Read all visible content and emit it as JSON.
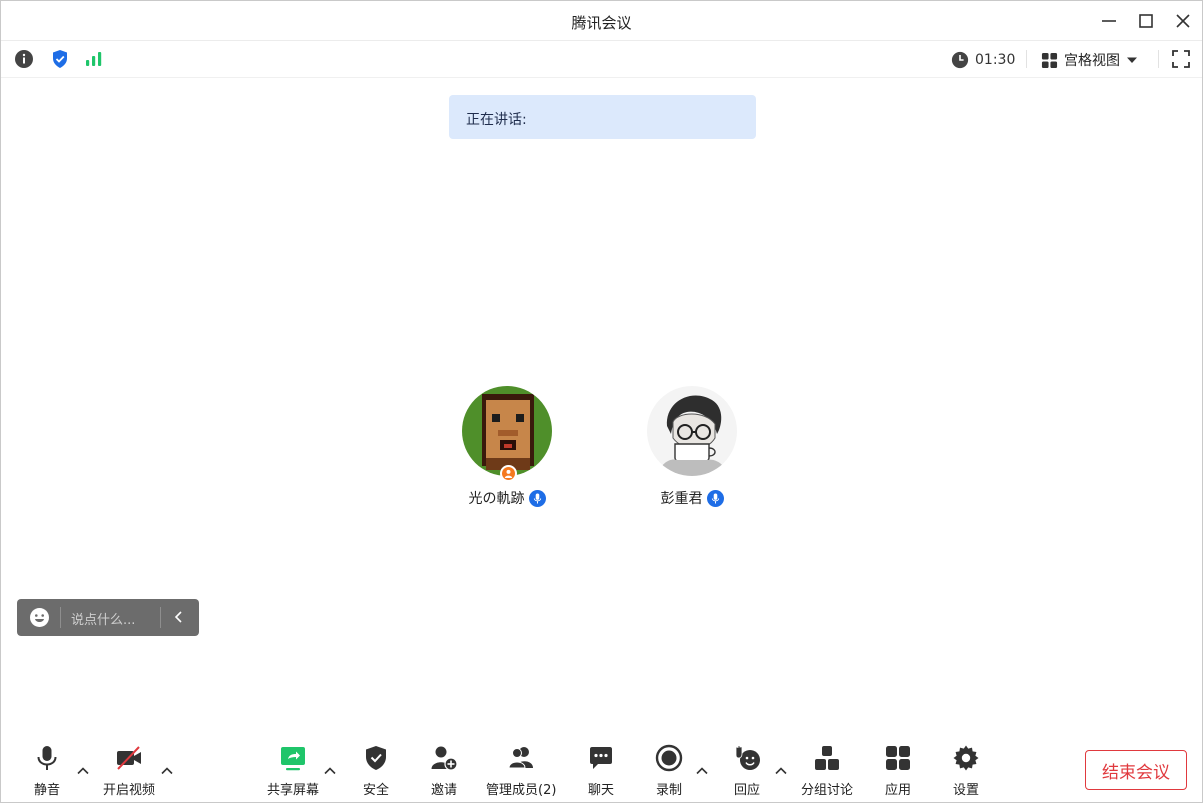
{
  "window": {
    "title": "腾讯会议"
  },
  "status": {
    "timer": "01:30",
    "view_mode": "宫格视图",
    "signal_color": "#1fc56a",
    "shield_color": "#1e6de6"
  },
  "speaking": {
    "label": "正在讲话:"
  },
  "participants": [
    {
      "name": "光の軌跡",
      "role": "host",
      "mic": "on"
    },
    {
      "name": "彭重君",
      "mic": "on"
    }
  ],
  "chat": {
    "placeholder": "说点什么..."
  },
  "toolbar": {
    "mute": "静音",
    "video": "开启视频",
    "share": "共享屏幕",
    "security": "安全",
    "invite": "邀请",
    "members": "管理成员(2)",
    "chat": "聊天",
    "record": "录制",
    "react": "回应",
    "breakout": "分组讨论",
    "apps": "应用",
    "settings": "设置",
    "end": "结束会议"
  },
  "colors": {
    "accent": "#1e6de6",
    "end_red": "#e0393e",
    "share_green": "#1fc56a",
    "host_orange": "#f57a1f"
  }
}
